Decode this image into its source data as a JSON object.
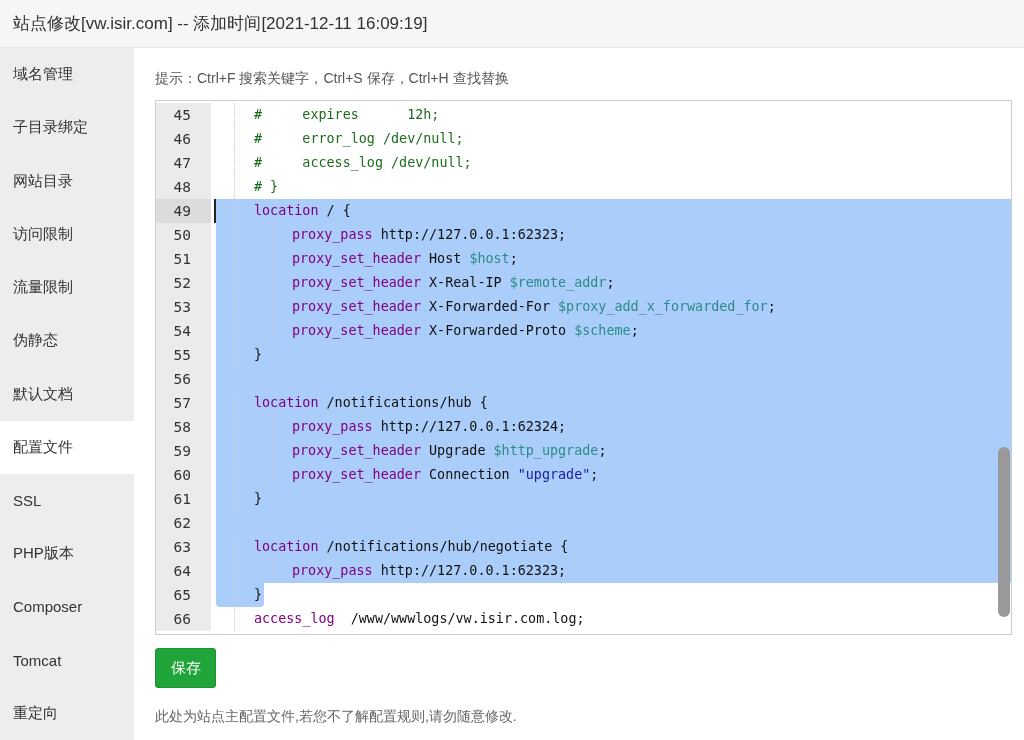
{
  "window": {
    "title": "站点修改[vw.isir.com] -- 添加时间[2021-12-11 16:09:19]"
  },
  "sidebar": {
    "items": [
      {
        "label": "域名管理",
        "selected": false
      },
      {
        "label": "子目录绑定",
        "selected": false
      },
      {
        "label": "网站目录",
        "selected": false
      },
      {
        "label": "访问限制",
        "selected": false
      },
      {
        "label": "流量限制",
        "selected": false
      },
      {
        "label": "伪静态",
        "selected": false
      },
      {
        "label": "默认文档",
        "selected": false
      },
      {
        "label": "配置文件",
        "selected": true
      },
      {
        "label": "SSL",
        "selected": false
      },
      {
        "label": "PHP版本",
        "selected": false
      },
      {
        "label": "Composer",
        "selected": false
      },
      {
        "label": "Tomcat",
        "selected": false
      },
      {
        "label": "重定向",
        "selected": false
      }
    ]
  },
  "hint": "提示：Ctrl+F 搜索关键字，Ctrl+S 保存，Ctrl+H 查找替换",
  "editor": {
    "lines": [
      {
        "number": "45",
        "selected": false,
        "tokens": [
          {
            "kind": "comment",
            "text": "#     expires      12h;"
          }
        ]
      },
      {
        "number": "46",
        "selected": false,
        "tokens": [
          {
            "kind": "comment",
            "text": "#     error_log /dev/null;"
          }
        ]
      },
      {
        "number": "47",
        "selected": false,
        "tokens": [
          {
            "kind": "comment",
            "text": "#     access_log /dev/null;"
          }
        ]
      },
      {
        "number": "48",
        "selected": false,
        "tokens": [
          {
            "kind": "comment",
            "text": "# }"
          }
        ]
      },
      {
        "number": "49",
        "selected": true,
        "cursor": true,
        "tokens": [
          {
            "kind": "keyword",
            "text": "location"
          },
          {
            "kind": "plain",
            "text": " / {"
          }
        ],
        "children": [
          {
            "number": "50",
            "selected": true,
            "tokens": [
              {
                "kind": "keyword",
                "text": "proxy_pass"
              },
              {
                "kind": "plain",
                "text": " http://127.0.0.1:62323;"
              }
            ]
          },
          {
            "number": "51",
            "selected": true,
            "tokens": [
              {
                "kind": "keyword",
                "text": "proxy_set_header"
              },
              {
                "kind": "plain",
                "text": " Host "
              },
              {
                "kind": "variable",
                "text": "$host"
              },
              {
                "kind": "plain",
                "text": ";"
              }
            ]
          },
          {
            "number": "52",
            "selected": true,
            "tokens": [
              {
                "kind": "keyword",
                "text": "proxy_set_header"
              },
              {
                "kind": "plain",
                "text": " X-Real-IP "
              },
              {
                "kind": "variable",
                "text": "$remote_addr"
              },
              {
                "kind": "plain",
                "text": ";"
              }
            ]
          },
          {
            "number": "53",
            "selected": true,
            "tokens": [
              {
                "kind": "keyword",
                "text": "proxy_set_header"
              },
              {
                "kind": "plain",
                "text": " X-Forwarded-For "
              },
              {
                "kind": "variable",
                "text": "$proxy_add_x_forwarded_for"
              },
              {
                "kind": "plain",
                "text": ";"
              }
            ]
          },
          {
            "number": "54",
            "selected": true,
            "tokens": [
              {
                "kind": "keyword",
                "text": "proxy_set_header"
              },
              {
                "kind": "plain",
                "text": " X-Forwarded-Proto "
              },
              {
                "kind": "variable",
                "text": "$scheme"
              },
              {
                "kind": "plain",
                "text": ";"
              }
            ]
          }
        ]
      },
      {
        "number": "55",
        "selected": true,
        "tokens": [
          {
            "kind": "plain",
            "text": "}"
          }
        ]
      },
      {
        "number": "56",
        "selected": true,
        "blank": true
      },
      {
        "number": "57",
        "selected": true,
        "tokens": [
          {
            "kind": "keyword",
            "text": "location"
          },
          {
            "kind": "plain",
            "text": " /notifications/hub {"
          }
        ],
        "children": [
          {
            "number": "58",
            "selected": true,
            "tokens": [
              {
                "kind": "keyword",
                "text": "proxy_pass"
              },
              {
                "kind": "plain",
                "text": " http://127.0.0.1:62324;"
              }
            ]
          },
          {
            "number": "59",
            "selected": true,
            "tokens": [
              {
                "kind": "keyword",
                "text": "proxy_set_header"
              },
              {
                "kind": "plain",
                "text": " Upgrade "
              },
              {
                "kind": "variable",
                "text": "$http_upgrade"
              },
              {
                "kind": "plain",
                "text": ";"
              }
            ]
          },
          {
            "number": "60",
            "selected": true,
            "tokens": [
              {
                "kind": "keyword",
                "text": "proxy_set_header"
              },
              {
                "kind": "plain",
                "text": " Connection "
              },
              {
                "kind": "string",
                "text": "\"upgrade\""
              },
              {
                "kind": "plain",
                "text": ";"
              }
            ]
          }
        ]
      },
      {
        "number": "61",
        "selected": true,
        "tokens": [
          {
            "kind": "plain",
            "text": "}"
          }
        ]
      },
      {
        "number": "62",
        "selected": true,
        "blank": true
      },
      {
        "number": "63",
        "selected": true,
        "tokens": [
          {
            "kind": "keyword",
            "text": "location"
          },
          {
            "kind": "plain",
            "text": " /notifications/hub/negotiate {"
          }
        ],
        "children": [
          {
            "number": "64",
            "selected": true,
            "tokens": [
              {
                "kind": "keyword",
                "text": "proxy_pass"
              },
              {
                "kind": "plain",
                "text": " http://127.0.0.1:62323;"
              }
            ]
          }
        ]
      },
      {
        "number": "65",
        "selected": true,
        "selection_ends_here": true,
        "tokens": [
          {
            "kind": "plain",
            "text": "}"
          }
        ]
      },
      {
        "number": "66",
        "selected": false,
        "tokens": [
          {
            "kind": "keyword",
            "text": "access_log"
          },
          {
            "kind": "plain",
            "text": "  /www/wwwlogs/vw.isir.com.log;"
          }
        ]
      }
    ]
  },
  "save_button": "保存",
  "note": "此处为站点主配置文件,若您不了解配置规则,请勿随意修改."
}
